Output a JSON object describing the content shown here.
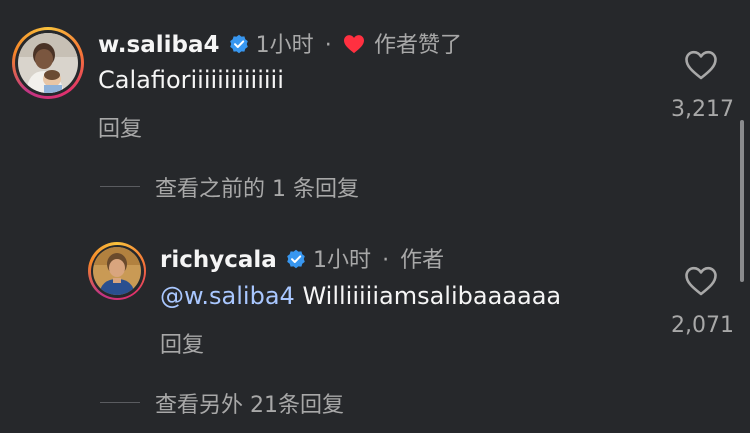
{
  "comments": [
    {
      "username": "w.saliba4",
      "time": "1小时",
      "separator": "·",
      "author_liked": "作者赞了",
      "text": "Calafioriiiiiiiiiiiiii",
      "reply_label": "回复",
      "like_count": "3,217"
    }
  ],
  "view_previous": "查看之前的 1 条回复",
  "replies": [
    {
      "username": "richycala",
      "time": "1小时",
      "separator": "·",
      "author_tag": "作者",
      "mention": "@w.saliba4",
      "text": "Williiiiiamsalibaaaaaa",
      "reply_label": "回复",
      "like_count": "2,071"
    }
  ],
  "view_more": "查看另外 21条回复",
  "colors": {
    "background": "#26282b",
    "verified": "#3897f0",
    "heart": "#ff3040",
    "mention": "#a9c7ff"
  },
  "icons": {
    "verified": "verified-badge-icon",
    "author_like": "red-heart-icon",
    "like": "heart-outline-icon"
  }
}
